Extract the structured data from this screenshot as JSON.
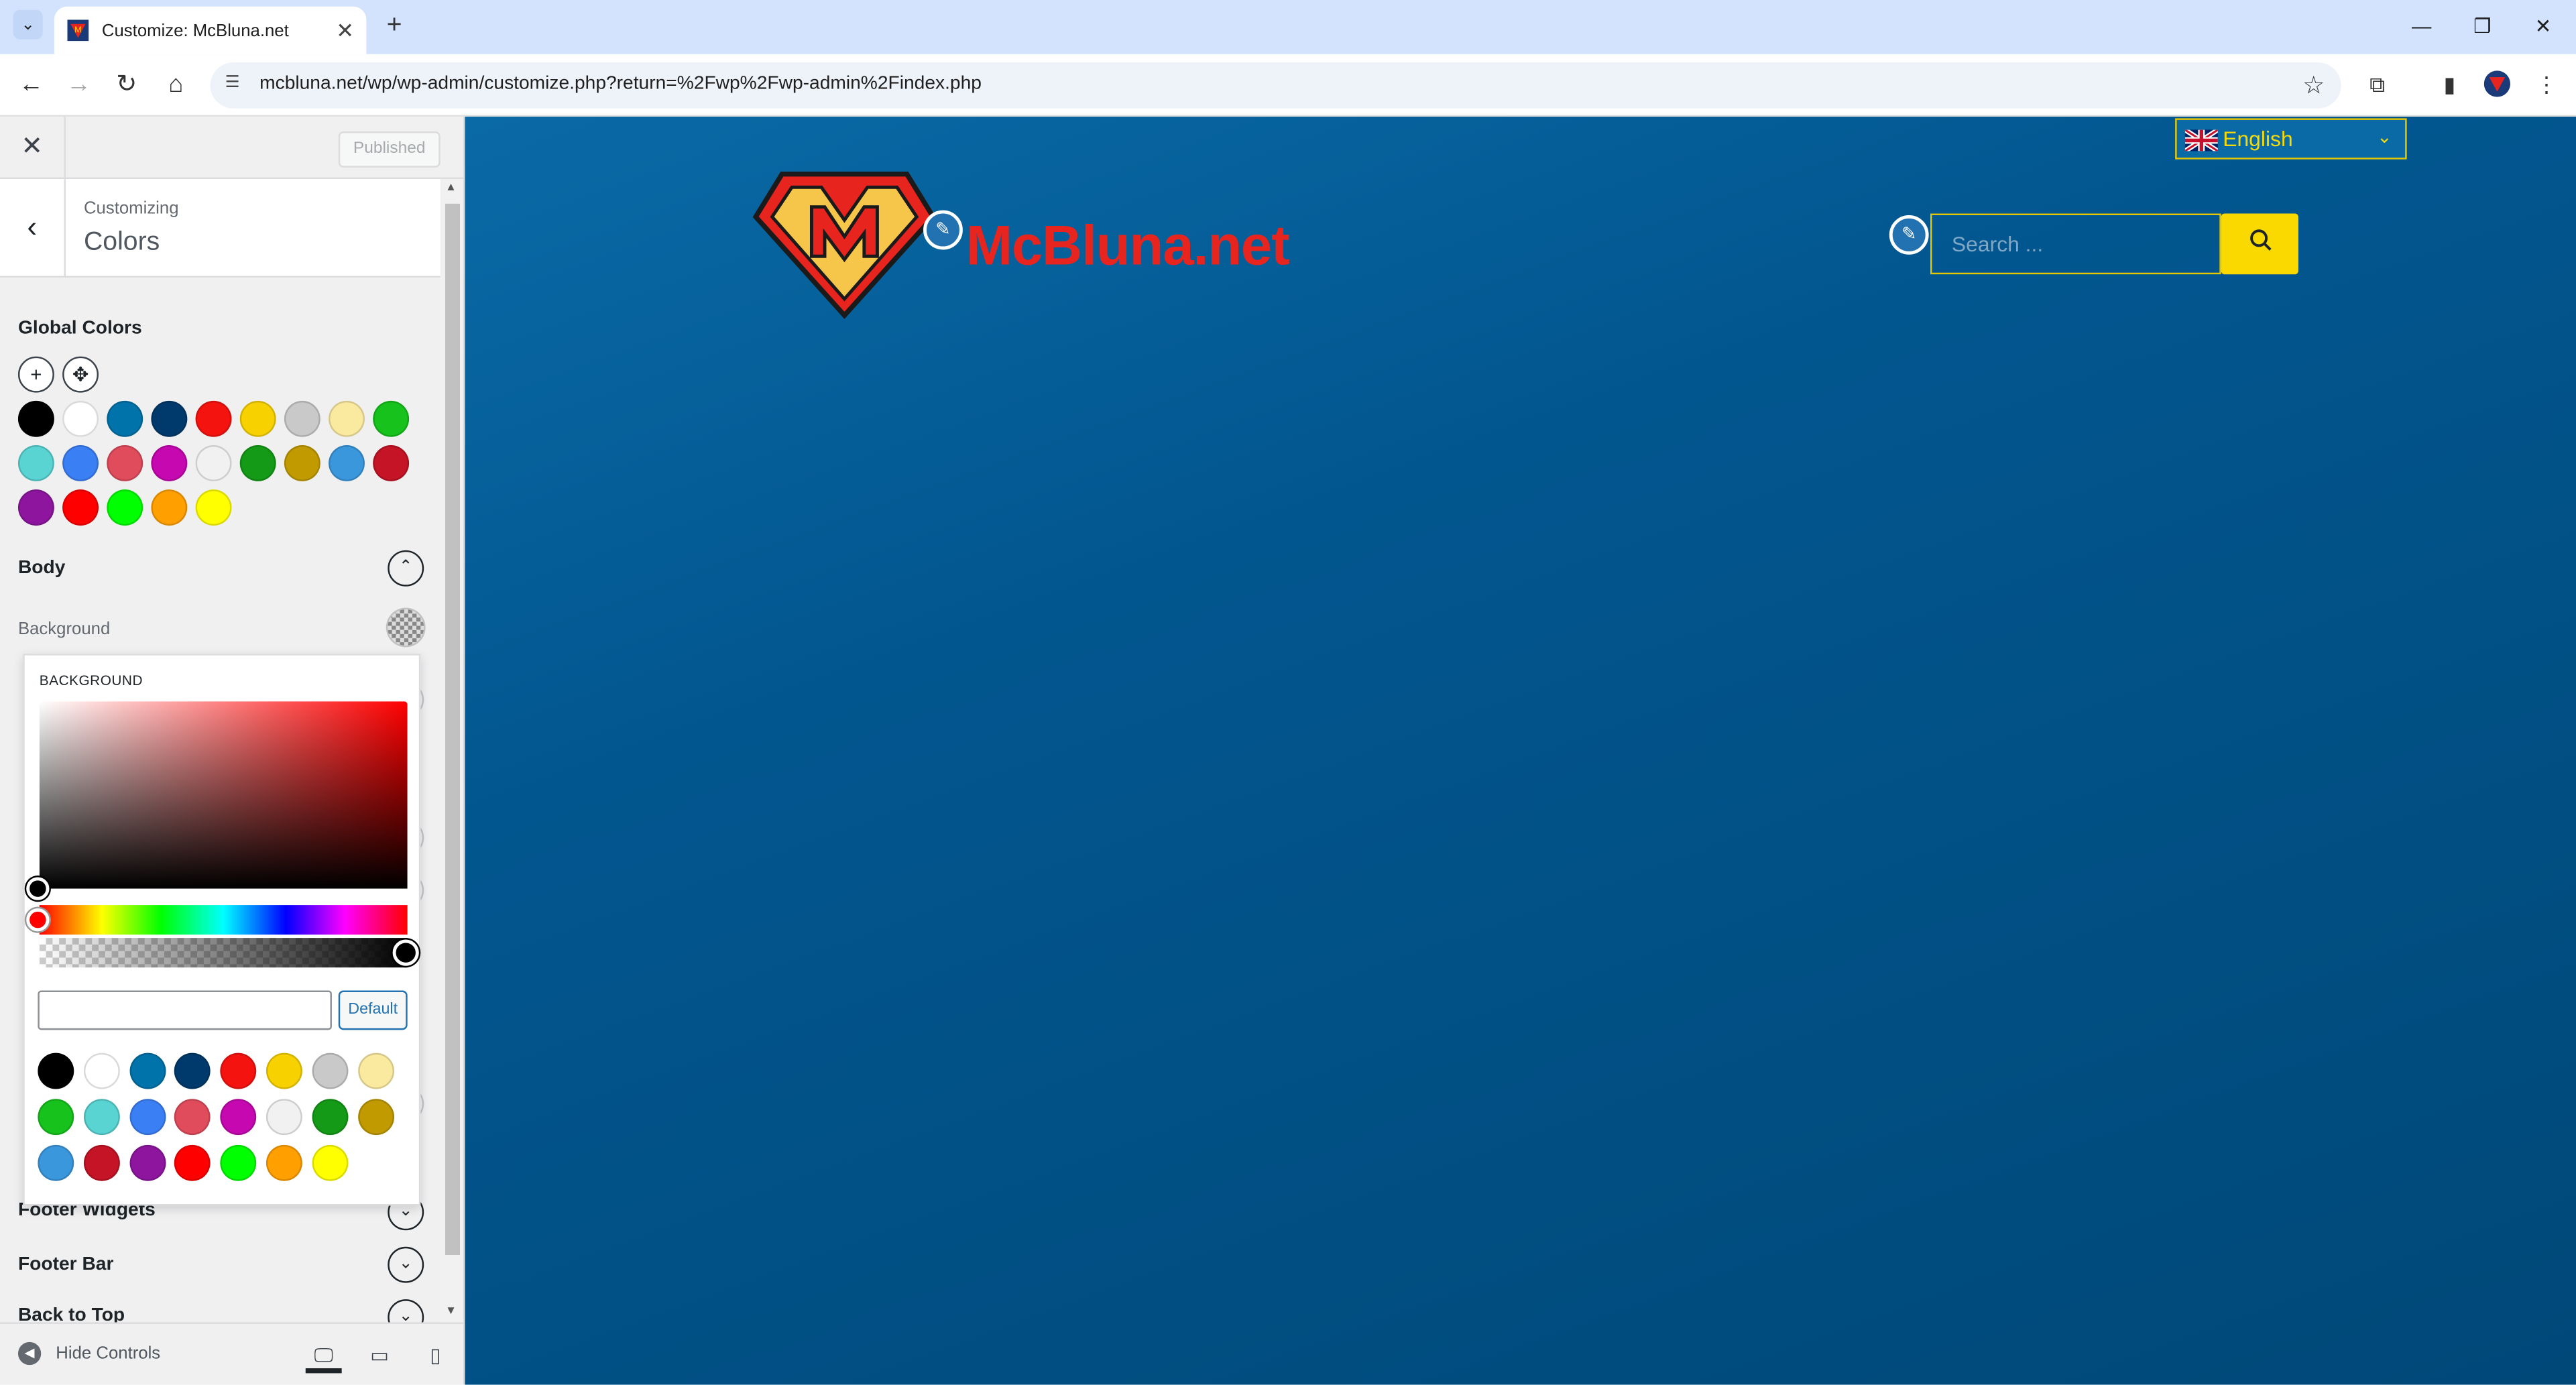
{
  "browser": {
    "tab_title": "Customize: McBluna.net",
    "url": "mcbluna.net/wp/wp-admin/customize.php?return=%2Fwp%2Fwp-admin%2Findex.php"
  },
  "customizer": {
    "published_label": "Published",
    "breadcrumb": "Customizing",
    "section_title": "Colors",
    "global_colors_label": "Global Colors",
    "palette": [
      "#000000",
      "#ffffff",
      "#0073aa",
      "#003a6c",
      "#f4130f",
      "#f7d200",
      "#c9c9c9",
      "#faeaa0",
      "#17c21d",
      "#5ad3d3",
      "#3b7ff5",
      "#e04c5c",
      "#c508b0",
      "#f1f1f1",
      "#159a17",
      "#c19a00",
      "#3b97dc",
      "#c41426",
      "#8e169f",
      "#ff0000",
      "#00ff00",
      "#ff9f00",
      "#ffff00"
    ],
    "body_label": "Body",
    "background_label": "Background",
    "footer_widgets_label": "Footer Widgets",
    "footer_bar_label": "Footer Bar",
    "back_to_top_label": "Back to Top",
    "hide_controls_label": "Hide Controls",
    "picker": {
      "title": "BACKGROUND",
      "hex_value": "",
      "default_label": "Default"
    }
  },
  "preview": {
    "language": "English",
    "site_name": "McBluna.net",
    "search_placeholder": "Search ..."
  }
}
